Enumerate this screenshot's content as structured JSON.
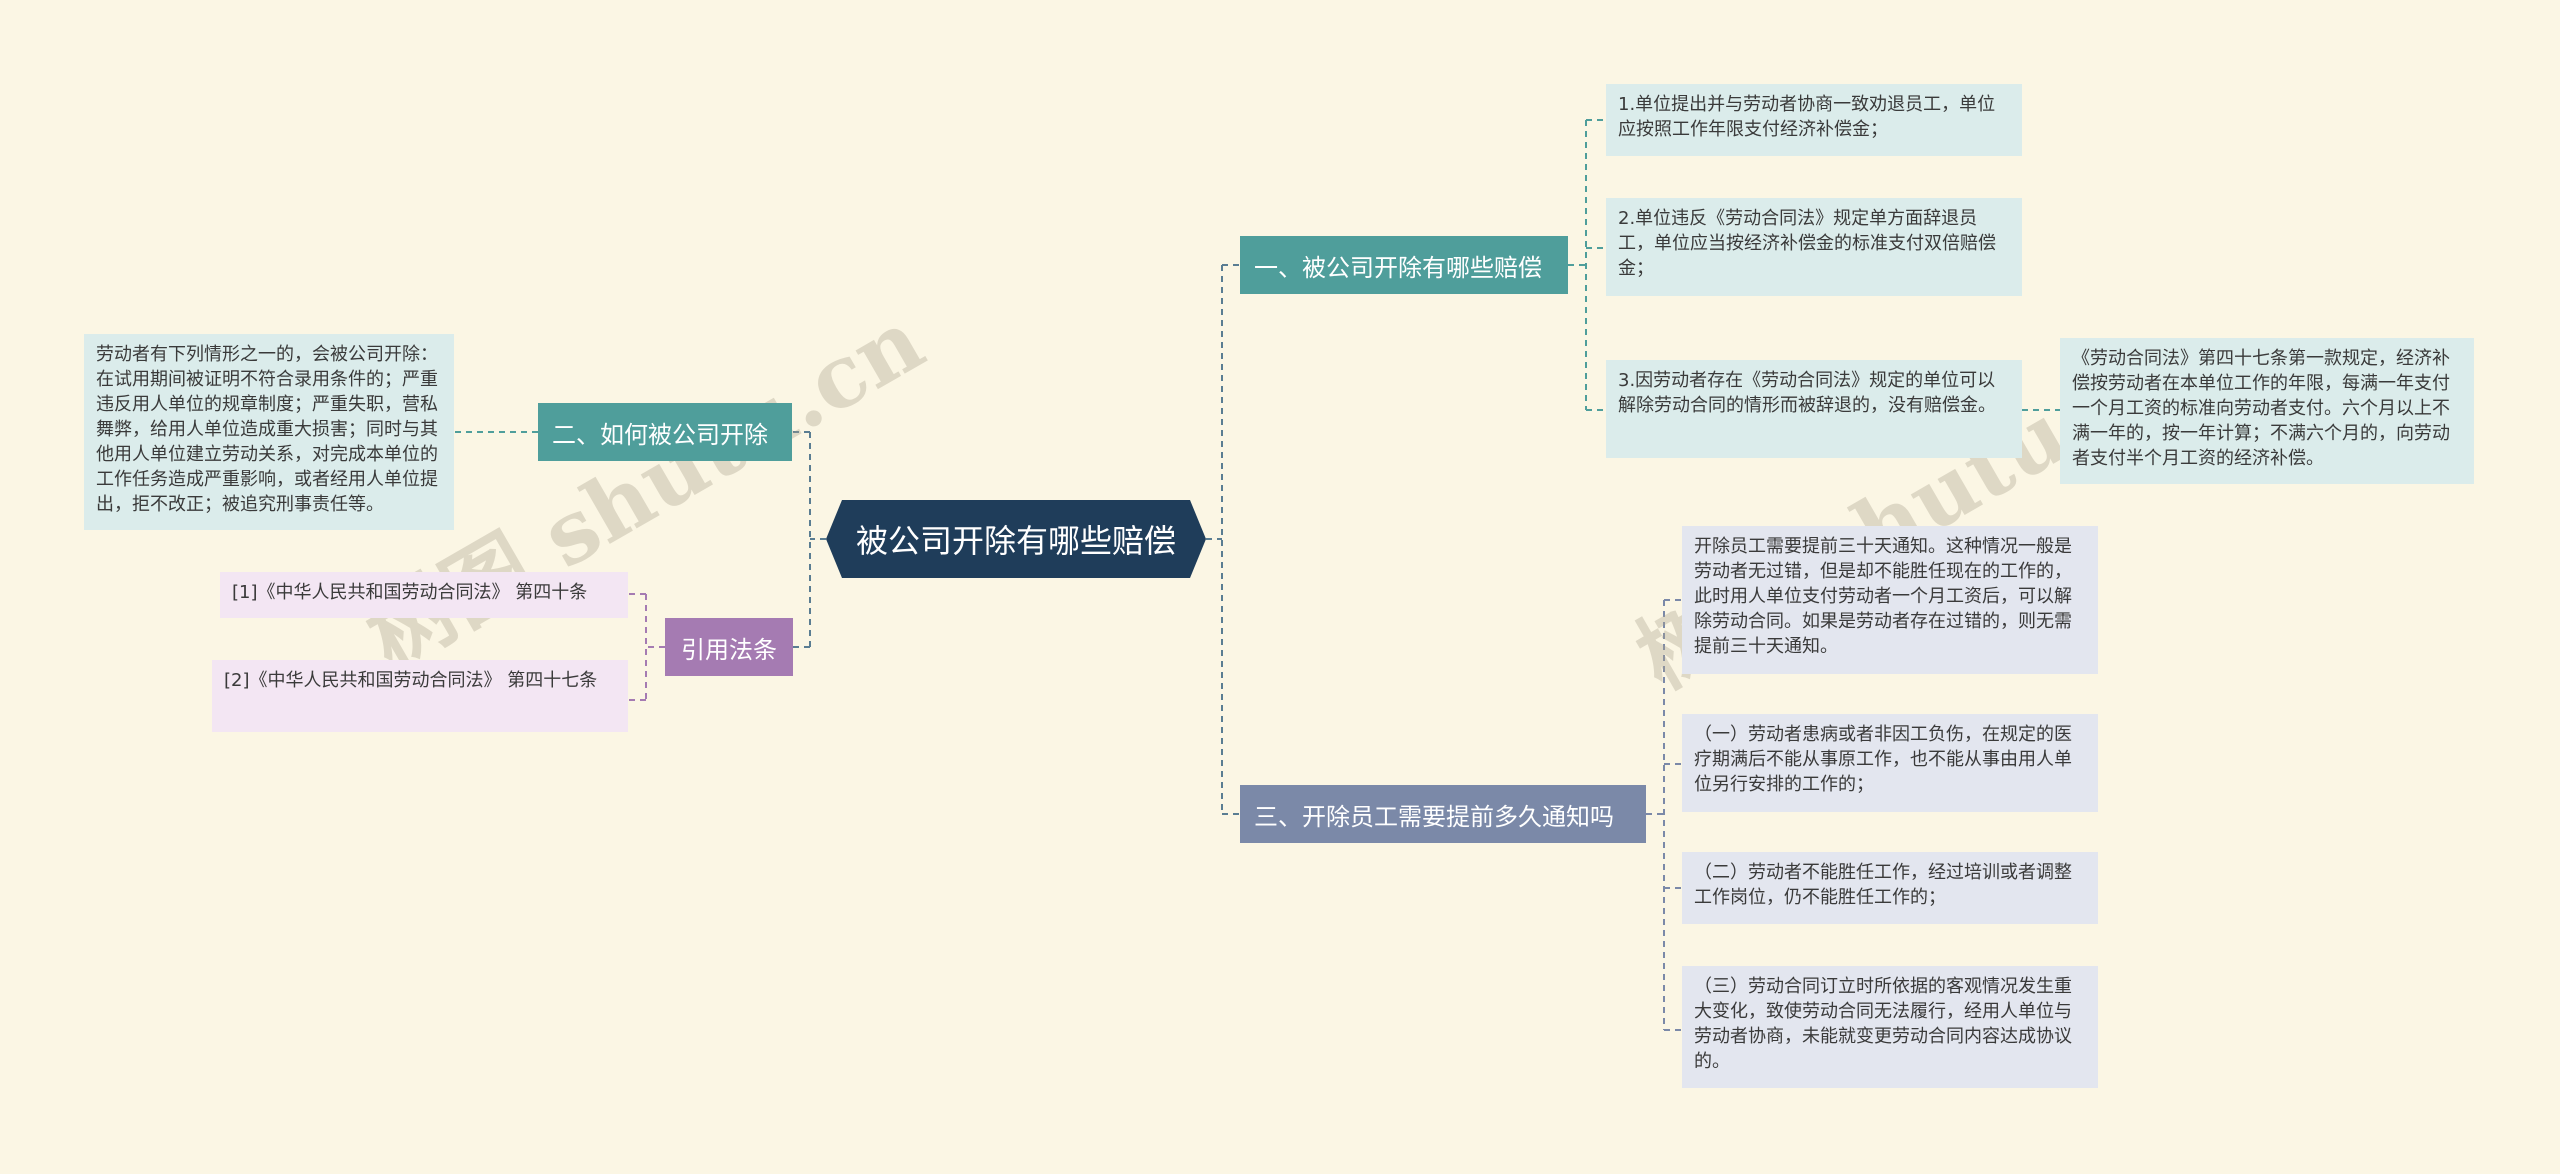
{
  "root": {
    "label": "被公司开除有哪些赔偿"
  },
  "branches": {
    "b1": {
      "label": "一、被公司开除有哪些赔偿",
      "items": [
        "1.单位提出并与劳动者协商一致劝退员工，单位应按照工作年限支付经济补偿金；",
        "2.单位违反《劳动合同法》规定单方面辞退员工，单位应当按经济补偿金的标准支付双倍赔偿金；",
        "3.因劳动者存在《劳动合同法》规定的单位可以解除劳动合同的情形而被辞退的，没有赔偿金。"
      ],
      "sub_note": "《劳动合同法》第四十七条第一款规定，经济补偿按劳动者在本单位工作的年限，每满一年支付一个月工资的标准向劳动者支付。六个月以上不满一年的，按一年计算；不满六个月的，向劳动者支付半个月工资的经济补偿。"
    },
    "b2": {
      "label": "二、如何被公司开除",
      "items": [
        "劳动者有下列情形之一的，会被公司开除：在试用期间被证明不符合录用条件的；严重违反用人单位的规章制度；严重失职，营私舞弊，给用人单位造成重大损害；同时与其他用人单位建立劳动关系，对完成本单位的工作任务造成严重影响，或者经用人单位提出，拒不改正；被追究刑事责任等。"
      ]
    },
    "b3": {
      "label": "引用法条",
      "items": [
        "[1]《中华人民共和国劳动合同法》 第四十条",
        "[2]《中华人民共和国劳动合同法》 第四十七条"
      ]
    },
    "b4": {
      "label": "三、开除员工需要提前多久通知吗",
      "items": [
        "开除员工需要提前三十天通知。这种情况一般是劳动者无过错，但是却不能胜任现在的工作的，此时用人单位支付劳动者一个月工资后，可以解除劳动合同。如果是劳动者存在过错的，则无需提前三十天通知。",
        "（一）劳动者患病或者非因工负伤，在规定的医疗期满后不能从事原工作，也不能从事由用人单位另行安排的工作的；",
        "（二）劳动者不能胜任工作，经过培训或者调整工作岗位，仍不能胜任工作的；",
        "（三）劳动合同订立时所依据的客观情况发生重大变化，致使劳动合同无法履行，经用人单位与劳动者协商，未能就变更劳动合同内容达成协议的。"
      ]
    }
  },
  "watermarks": [
    "树图 shutu.cn",
    "树图 shutu.cn"
  ],
  "colors": {
    "background": "#fbf6e4",
    "root": "#1f3d5a",
    "teal_branch": "#4f9e9b",
    "purple_branch": "#a57bb2",
    "slate_branch": "#7b89a8",
    "teal_leaf": "#dbeceb",
    "purple_leaf": "#f3e6f3",
    "slate_leaf": "#e3e6ef"
  }
}
